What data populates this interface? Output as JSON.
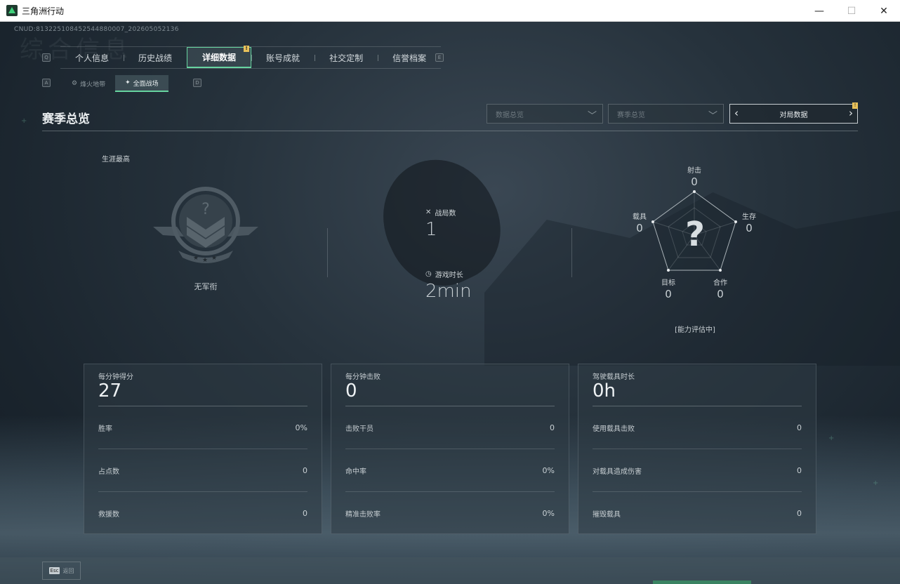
{
  "window": {
    "title": "三角洲行动",
    "minimize": "—",
    "maximize": "☐",
    "close": "✕"
  },
  "uid": "CNUD:813225108452544880007_20260505213​6",
  "watermark": "综合信息",
  "key_hints": {
    "tab_prev": "Q",
    "tab_next": "E",
    "sub_prev": "A",
    "sub_next": "D"
  },
  "tabs": [
    {
      "label": "个人信息",
      "active": false
    },
    {
      "label": "历史战绩",
      "active": false
    },
    {
      "label": "详细数据",
      "active": true,
      "badge": "!"
    },
    {
      "label": "账号成就",
      "active": false
    },
    {
      "label": "社交定制",
      "active": false
    },
    {
      "label": "信誉档案",
      "active": false
    }
  ],
  "subtabs": [
    {
      "label": "烽火地带",
      "icon": "⚙",
      "active": false
    },
    {
      "label": "全面战场",
      "icon": "✦",
      "active": true
    }
  ],
  "section": {
    "title": "赛季总览"
  },
  "filters": {
    "data_overview": "数据总览",
    "season_overview": "赛季总览",
    "match_data": "对局数据",
    "match_badge": "!"
  },
  "career": {
    "label": "生涯最高",
    "rank_name": "无军衔",
    "emblem_mark": "?"
  },
  "stats": {
    "matches_label": "战局数",
    "matches_value": "1",
    "playtime_label": "游戏时长",
    "playtime_value": "2min"
  },
  "radar": {
    "center_mark": "?",
    "axes": [
      {
        "label": "射击",
        "value": "0"
      },
      {
        "label": "生存",
        "value": "0"
      },
      {
        "label": "合作",
        "value": "0"
      },
      {
        "label": "目标",
        "value": "0"
      },
      {
        "label": "载具",
        "value": "0"
      }
    ],
    "status": "[能力评估中]"
  },
  "cards": [
    {
      "head": "每分钟得分",
      "big": "27",
      "rows": [
        {
          "label": "胜率",
          "value": "0%"
        },
        {
          "label": "占点数",
          "value": "0"
        },
        {
          "label": "救援数",
          "value": "0"
        }
      ]
    },
    {
      "head": "每分钟击败",
      "big": "0",
      "rows": [
        {
          "label": "击败干员",
          "value": "0"
        },
        {
          "label": "命中率",
          "value": "0%"
        },
        {
          "label": "精准击败率",
          "value": "0%"
        }
      ]
    },
    {
      "head": "驾驶载具时长",
      "big": "0h",
      "rows": [
        {
          "label": "使用载具击败",
          "value": "0"
        },
        {
          "label": "对载具造成伤害",
          "value": "0"
        },
        {
          "label": "摧毁载具",
          "value": "0"
        }
      ]
    }
  ],
  "footer": {
    "esc_key": "Esc",
    "back_label": "返回"
  },
  "colors": {
    "accent": "#67d4a0",
    "badge": "#e8c15a",
    "background": "#1d2832"
  }
}
